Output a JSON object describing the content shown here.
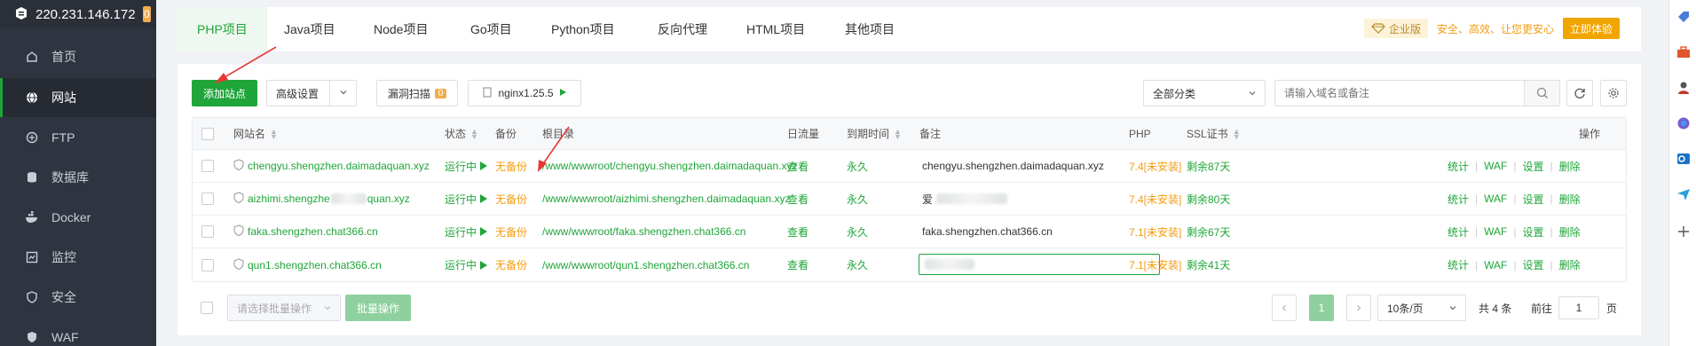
{
  "server": {
    "ip": "220.231.146.172",
    "badge": "0"
  },
  "sidebar": {
    "items": [
      {
        "label": "首页",
        "icon": "home-icon"
      },
      {
        "label": "网站",
        "icon": "globe-icon",
        "active": true
      },
      {
        "label": "FTP",
        "icon": "ftp-icon"
      },
      {
        "label": "数据库",
        "icon": "database-icon"
      },
      {
        "label": "Docker",
        "icon": "docker-icon"
      },
      {
        "label": "监控",
        "icon": "monitor-icon"
      },
      {
        "label": "安全",
        "icon": "shield-icon"
      },
      {
        "label": "WAF",
        "icon": "waf-icon"
      }
    ]
  },
  "tabs": [
    {
      "label": "PHP项目",
      "active": true
    },
    {
      "label": "Java项目"
    },
    {
      "label": "Node项目"
    },
    {
      "label": "Go项目"
    },
    {
      "label": "Python项目"
    },
    {
      "label": "反向代理"
    },
    {
      "label": "HTML项目"
    },
    {
      "label": "其他项目"
    }
  ],
  "promo": {
    "edition": "企业版",
    "text": "安全、高效、让您更安心",
    "button": "立即体验"
  },
  "toolbar": {
    "add_site": "添加站点",
    "advanced": "高级设置",
    "vuln_scan": "漏洞扫描",
    "vuln_count": "0",
    "nginx": "nginx1.25.5",
    "category": "全部分类",
    "search_placeholder": "请输入域名或备注"
  },
  "table": {
    "headers": {
      "name": "网站名",
      "status": "状态",
      "backup": "备份",
      "root": "根目录",
      "traffic": "日流量",
      "expire": "到期时间",
      "note": "备注",
      "php": "PHP",
      "ssl": "SSL证书",
      "ops": "操作"
    },
    "rows": [
      {
        "name": "chengyu.shengzhen.daimadaquan.xyz",
        "status": "运行中",
        "backup": "无备份",
        "root": "/www/wwwroot/chengyu.shengzhen.daimadaquan.xyz",
        "traffic": "查看",
        "expire": "永久",
        "note": "chengyu.shengzhen.daimadaquan.xyz",
        "php": "7.4[未安装]",
        "ssl": "剩余87天"
      },
      {
        "name_pre": "aizhimi.shengzhe",
        "name_post": "quan.xyz",
        "status": "运行中",
        "backup": "无备份",
        "root": "/www/wwwroot/aizhimi.shengzhen.daimadaquan.xyz",
        "traffic": "查看",
        "expire": "永久",
        "note": "爱",
        "php": "7.4[未安装]",
        "ssl": "剩余80天"
      },
      {
        "name": "faka.shengzhen.chat366.cn",
        "status": "运行中",
        "backup": "无备份",
        "root": "/www/wwwroot/faka.shengzhen.chat366.cn",
        "traffic": "查看",
        "expire": "永久",
        "note": "faka.shengzhen.chat366.cn",
        "php": "7.1[未安装]",
        "ssl": "剩余67天"
      },
      {
        "name": "qun1.shengzhen.chat366.cn",
        "status": "运行中",
        "backup": "无备份",
        "root": "/www/wwwroot/qun1.shengzhen.chat366.cn",
        "traffic": "查看",
        "expire": "永久",
        "note": "",
        "php": "7.1[未安装]",
        "ssl": "剩余41天"
      }
    ],
    "ops": [
      "统计",
      "WAF",
      "设置",
      "删除"
    ]
  },
  "footer": {
    "batch_placeholder": "请选择批量操作",
    "batch_button": "批量操作",
    "current_page": "1",
    "page_size": "10条/页",
    "total": "共 4 条",
    "goto_label": "前往",
    "goto_value": "1",
    "page_suffix": "页"
  },
  "colors": {
    "accent": "#20a53a",
    "warning": "#f39c12",
    "danger": "#f56c6c",
    "sidebar": "#2f3540"
  }
}
